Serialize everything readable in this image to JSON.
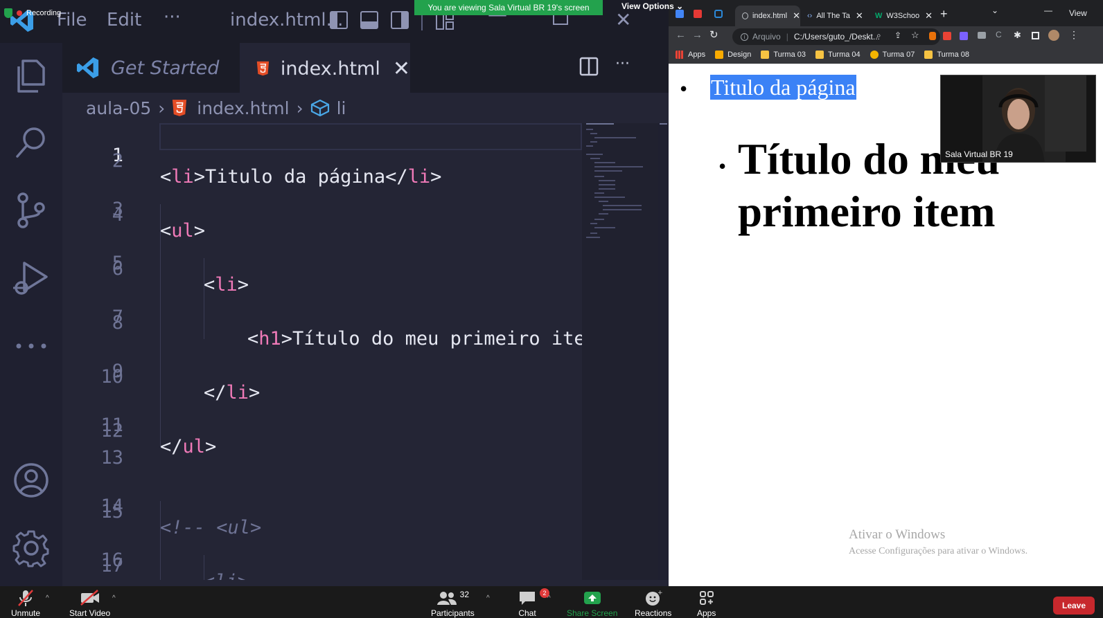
{
  "zoom": {
    "banner": "You are viewing Sala Virtual BR 19's screen",
    "view_options": "View Options",
    "recording": "Recording",
    "participant_count": "32",
    "chat_badge": "2",
    "toolbar": [
      {
        "label": "Unmute",
        "icon": "microphone-muted-icon"
      },
      {
        "label": "Start Video",
        "icon": "video-off-icon"
      },
      {
        "label": "Participants",
        "icon": "participants-icon"
      },
      {
        "label": "Chat",
        "icon": "chat-icon"
      },
      {
        "label": "Share Screen",
        "icon": "share-screen-icon"
      },
      {
        "label": "Reactions",
        "icon": "reactions-icon"
      },
      {
        "label": "Apps",
        "icon": "apps-icon"
      }
    ],
    "leave": "Leave",
    "video_label": "Sala Virtual BR 19",
    "share_color": "#23a24d",
    "leave_color": "#c7282d"
  },
  "vscode": {
    "menu": [
      "File",
      "Edit",
      "···"
    ],
    "title": "index.html...",
    "tabs": [
      {
        "label": "Get Started",
        "icon": "vscode-logo-icon"
      },
      {
        "label": "index.html",
        "icon": "html5-icon"
      }
    ],
    "breadcrumb": {
      "folder": "aula-05",
      "file": "index.html",
      "symbol": "li"
    },
    "line_numbers": [
      "1",
      "2",
      "3",
      "4",
      "5",
      "6",
      "7",
      "8",
      "9",
      "10",
      "11",
      "12",
      "13",
      "14",
      "15",
      "16",
      "17"
    ],
    "code": {
      "l1": {
        "open": "<",
        "tag": "li",
        "close": ">",
        "text": "Titulo da página",
        "end_open": "</",
        "end_tag": "li",
        "end_close": ">"
      },
      "l3": {
        "open": "<",
        "tag": "ul",
        "close": ">"
      },
      "l5": {
        "open": "<",
        "tag": "li",
        "close": ">"
      },
      "l7": {
        "open": "<",
        "tag": "h1",
        "close": ">",
        "text": "Título do meu primeiro item"
      },
      "l9": {
        "open": "</",
        "tag": "li",
        "close": ">"
      },
      "l11": {
        "open": "</",
        "tag": "ul",
        "close": ">"
      },
      "l14": "<!-- <ul>",
      "l16": "<li>"
    },
    "tag_color": "#f07ab8"
  },
  "browser": {
    "tabs": [
      {
        "label": "index.html"
      },
      {
        "label": "All The Ta"
      },
      {
        "label": "W3Schoo"
      }
    ],
    "address": {
      "scheme": "Arquivo",
      "path": "C:/Users/guto_/Deskt..."
    },
    "bookmarks": [
      "Apps",
      "Design",
      "Turma 03",
      "Turma 04",
      "Turma 07",
      "Turma 08"
    ],
    "view_label": "View",
    "page": {
      "li": "Titulo da página",
      "h1": "Título do meu primeiro item"
    },
    "activate_title": "Ativar o Windows",
    "activate_sub": "Acesse Configurações para ativar o Windows."
  }
}
